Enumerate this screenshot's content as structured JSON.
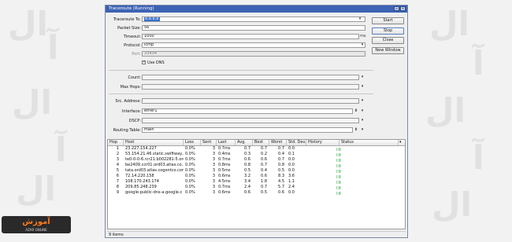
{
  "window": {
    "title": "Traceroute (Running)"
  },
  "form": {
    "traceroute_to": {
      "label": "Traceroute To:",
      "value": "8.8.8.8"
    },
    "packet_size": {
      "label": "Packet Size:",
      "value": "56"
    },
    "timeout": {
      "label": "Timeout:",
      "value": "1000",
      "unit": "ms"
    },
    "protocol": {
      "label": "Protocol:",
      "value": "icmp"
    },
    "port": {
      "label": "Port:",
      "value": "33434"
    },
    "use_dns": {
      "label": "Use DNS",
      "checked": true
    },
    "count": {
      "label": "Count:",
      "value": ""
    },
    "max_hops": {
      "label": "Max Hops:",
      "value": ""
    },
    "src_address": {
      "label": "Src. Address:",
      "value": ""
    },
    "interface": {
      "label": "Interface:",
      "value": "ether1"
    },
    "dscp": {
      "label": "DSCP:",
      "value": ""
    },
    "routing_table": {
      "label": "Routing Table:",
      "value": "main"
    }
  },
  "buttons": {
    "start": "Start",
    "stop": "Stop",
    "close": "Close",
    "new_window": "New Window"
  },
  "table": {
    "columns": [
      "Hop",
      "Host",
      "Loss",
      "Sent",
      "Last",
      "Avg.",
      "Best",
      "Worst",
      "Std. Dev.",
      "History",
      "Status"
    ],
    "rows": [
      {
        "hop": "1",
        "host": "23.227.154.227",
        "loss": "0.0%",
        "sent": "3",
        "last": "0.7ms",
        "avg": "0.7",
        "best": "0.7",
        "worst": "0.7",
        "std": "0.0"
      },
      {
        "hop": "2",
        "host": "53.154.21.46.static.swiftway...",
        "loss": "0.0%",
        "sent": "3",
        "last": "0.4ms",
        "avg": "0.3",
        "best": "0.2",
        "worst": "0.4",
        "std": "0.1"
      },
      {
        "hop": "3",
        "host": "te0-0-0-6.rcr21.b002281-5.ore...",
        "loss": "0.0%",
        "sent": "3",
        "last": "0.7ms",
        "avg": "0.6",
        "best": "0.6",
        "worst": "0.7",
        "std": "0.0"
      },
      {
        "hop": "4",
        "host": "be2409.ccr01.ord03.atlas.co...",
        "loss": "0.0%",
        "sent": "3",
        "last": "0.8ms",
        "avg": "0.8",
        "best": "0.7",
        "worst": "0.8",
        "std": "0.0"
      },
      {
        "hop": "5",
        "host": "tata.ord03.atlas.cogentco.com",
        "loss": "0.0%",
        "sent": "3",
        "last": "0.5ms",
        "avg": "0.5",
        "best": "0.4",
        "worst": "0.5",
        "std": "0.0"
      },
      {
        "hop": "6",
        "host": "72.14.220.158",
        "loss": "0.0%",
        "sent": "3",
        "last": "0.6ms",
        "avg": "3.2",
        "best": "0.6",
        "worst": "8.3",
        "std": "3.6"
      },
      {
        "hop": "7",
        "host": "108.170.243.174",
        "loss": "0.0%",
        "sent": "3",
        "last": "4.5ms",
        "avg": "3.4",
        "best": "1.8",
        "worst": "4.5",
        "std": "1.1"
      },
      {
        "hop": "8",
        "host": "209.85.248.239",
        "loss": "0.0%",
        "sent": "3",
        "last": "0.7ms",
        "avg": "2.4",
        "best": "0.7",
        "worst": "5.7",
        "std": "2.4"
      },
      {
        "hop": "9",
        "host": "google-public-dns-a.google.c",
        "loss": "0.0%",
        "sent": "3",
        "last": "0.6ms",
        "avg": "0.6",
        "best": "0.5",
        "worst": "0.6",
        "std": "0.0"
      }
    ]
  },
  "status_bar": {
    "text": "9 items"
  },
  "watermark": {
    "logo_text": "آموزش",
    "logo_sub": "AZAR ONLINE"
  }
}
